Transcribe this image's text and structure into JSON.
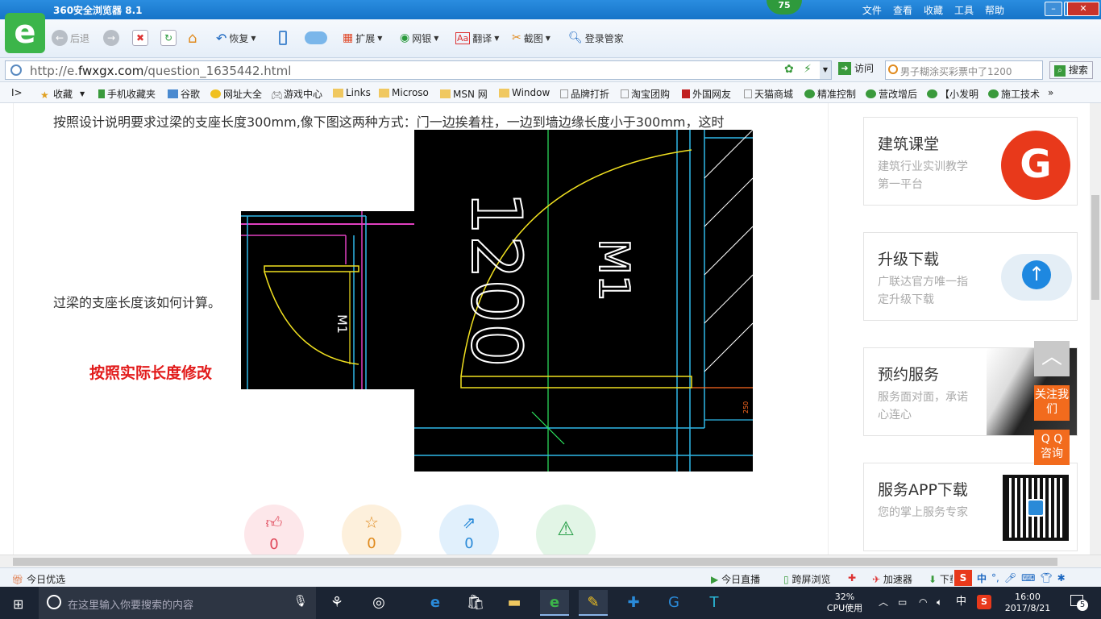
{
  "browser": {
    "title": "360安全浏览器 8.1",
    "menus": [
      "文件",
      "查看",
      "收藏",
      "工具",
      "帮助"
    ],
    "badge": "75",
    "toolbar": {
      "back": "后退",
      "restore": "恢复",
      "extend": "扩展",
      "netbank": "网银",
      "translate": "翻译",
      "screenshot": "截图",
      "login": "登录管家"
    },
    "address": {
      "url_prefix": "http://e.",
      "url_domain": "fwxgx.com",
      "url_path": "/question_1635442.html",
      "visit": "访问",
      "search_placeholder": "男子糊涂买彩票中了1200",
      "search_button": "搜索"
    },
    "favorites": [
      "收藏",
      "手机收藏夹",
      "谷歌",
      "网址大全",
      "游戏中心",
      "Links",
      "Microso",
      "MSN 网",
      "Window",
      "品牌打折",
      "淘宝团购",
      "外国网友",
      "天猫商城",
      "精准控制",
      "营改增后",
      "【小发明",
      "施工技术"
    ]
  },
  "article": {
    "para1": "按照设计说明要求过梁的支座长度300mm,像下图这两种方式：门一边挨着柱，一边到墙边缘长度小于300mm，这时",
    "para2": "过梁的支座长度该如何计算。",
    "fix_label": "按照实际长度修改",
    "cad_small_label": "M1",
    "cad_big_label1": "1200",
    "cad_big_label2": "M1",
    "cad_dim": "250"
  },
  "social": {
    "like": "0",
    "favorite": "0",
    "share": "0"
  },
  "sidebar": {
    "cards": [
      {
        "title": "建筑课堂",
        "desc": "建筑行业实训教学第一平台"
      },
      {
        "title": "升级下载",
        "desc": "广联达官方唯一指定升级下载"
      },
      {
        "title": "预约服务",
        "desc": "服务面对面，承诺心连心"
      },
      {
        "title": "服务APP下载",
        "desc": "您的掌上服务专家"
      }
    ],
    "follow_btn": "关注我们",
    "qq_btn": "Q Q 咨询"
  },
  "statusbar": {
    "today_pick": "今日优选",
    "live": "今日直播",
    "cross_screen": "跨屏浏览",
    "accelerator": "加速器",
    "download": "下载"
  },
  "taskbar": {
    "search_placeholder": "在这里输入你要搜索的内容",
    "cpu_percent": "32%",
    "cpu_label": "CPU使用",
    "ime": "中",
    "time": "16:00",
    "date": "2017/8/21",
    "notifications": "5"
  },
  "colors": {
    "titlebar": "#1673c8",
    "accent_red": "#e21b1b",
    "orange_btn": "#f26b1d",
    "cad_yellow": "#f0e020",
    "cad_cyan": "#2fb8e8",
    "cad_magenta": "#e040c0"
  }
}
